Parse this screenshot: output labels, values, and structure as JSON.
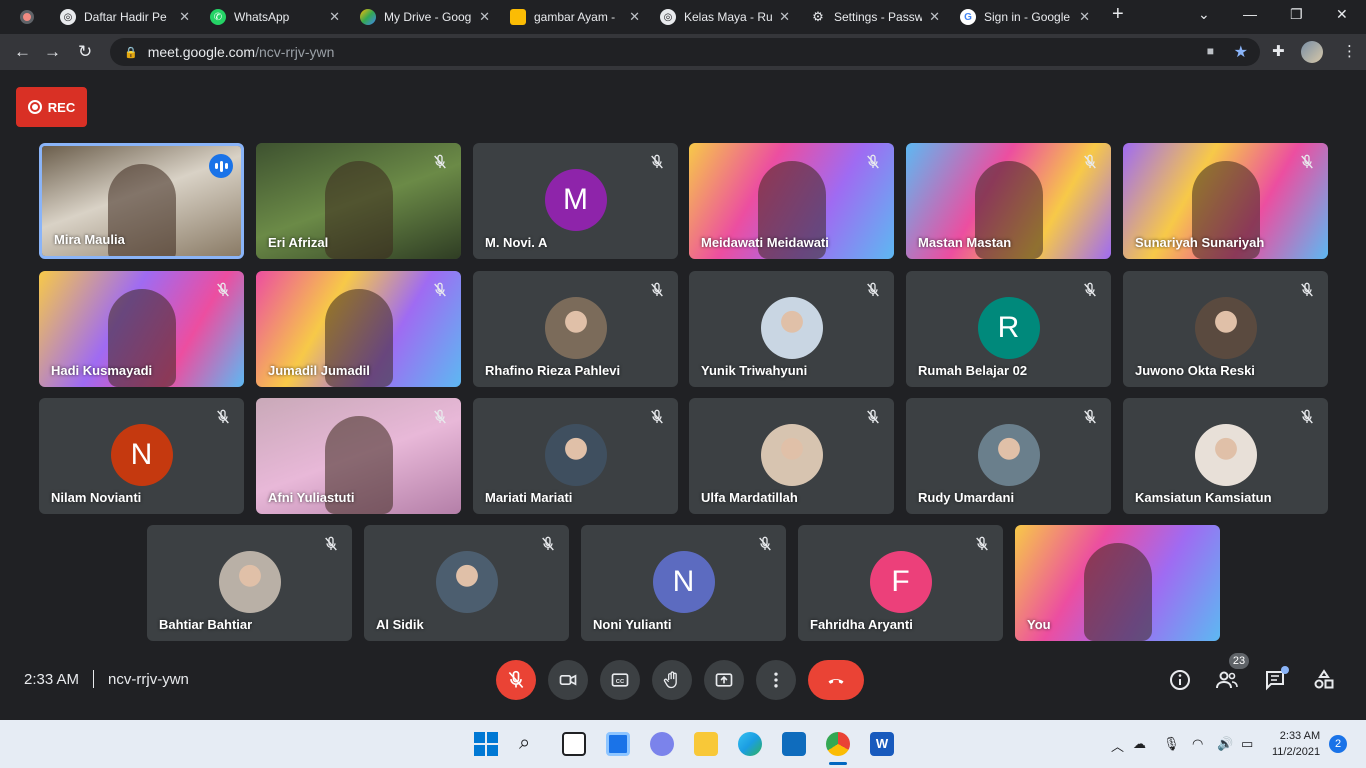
{
  "browser": {
    "tabs": [
      {
        "title": "Daftar Hadir Pe",
        "icon": "globe-icon",
        "active": false
      },
      {
        "title": "WhatsApp",
        "icon": "whatsapp-icon",
        "active": false
      },
      {
        "title": "My Drive - Goog",
        "icon": "drive-icon",
        "active": false
      },
      {
        "title": "gambar Ayam -",
        "icon": "slides-icon",
        "active": false
      },
      {
        "title": "Kelas Maya - Ru",
        "icon": "globe-icon",
        "active": false
      },
      {
        "title": "Settings - Passw",
        "icon": "gear-icon",
        "active": false
      },
      {
        "title": "Sign in - Google",
        "icon": "google-icon",
        "active": false
      }
    ],
    "new_tab": "+",
    "url_host": "meet.google.com",
    "url_path": "/ncv-rrjv-ywn"
  },
  "meet": {
    "rec_label": "REC",
    "participants": [
      {
        "name": "Mira Maulia",
        "kind": "video",
        "speaking": true
      },
      {
        "name": "Eri Afrizal",
        "kind": "video"
      },
      {
        "name": "M. Novi. A",
        "kind": "letter",
        "letter": "M",
        "color": "#8e24aa"
      },
      {
        "name": "Meidawati Meidawati",
        "kind": "video"
      },
      {
        "name": "Mastan Mastan",
        "kind": "video"
      },
      {
        "name": "Sunariyah Sunariyah",
        "kind": "video"
      },
      {
        "name": "Hadi Kusmayadi",
        "kind": "video"
      },
      {
        "name": "Jumadil Jumadil",
        "kind": "video"
      },
      {
        "name": "Rhafino Rieza Pahlevi",
        "kind": "photo"
      },
      {
        "name": "Yunik Triwahyuni",
        "kind": "photo"
      },
      {
        "name": "Rumah Belajar 02",
        "kind": "letter",
        "letter": "R",
        "color": "#00897b"
      },
      {
        "name": "Juwono Okta Reski",
        "kind": "photo"
      },
      {
        "name": "Nilam Novianti",
        "kind": "letter",
        "letter": "N",
        "color": "#c5390f"
      },
      {
        "name": "Afni Yuliastuti",
        "kind": "video"
      },
      {
        "name": "Mariati Mariati",
        "kind": "photo"
      },
      {
        "name": "Ulfa Mardatillah",
        "kind": "photo"
      },
      {
        "name": "Rudy Umardani",
        "kind": "photo"
      },
      {
        "name": "Kamsiatun Kamsiatun",
        "kind": "photo"
      },
      {
        "name": "Bahtiar Bahtiar",
        "kind": "photo"
      },
      {
        "name": "Al Sidik",
        "kind": "photo"
      },
      {
        "name": "Noni Yulianti",
        "kind": "letter",
        "letter": "N",
        "color": "#5c6bc0"
      },
      {
        "name": "Fahridha Aryanti",
        "kind": "letter",
        "letter": "F",
        "color": "#ec407a"
      },
      {
        "name": "You",
        "kind": "video"
      }
    ],
    "time": "2:33 AM",
    "meeting_code": "ncv-rrjv-ywn",
    "people_count": "23"
  },
  "taskbar": {
    "time": "2:33 AM",
    "date": "11/2/2021",
    "notifications": "2"
  }
}
